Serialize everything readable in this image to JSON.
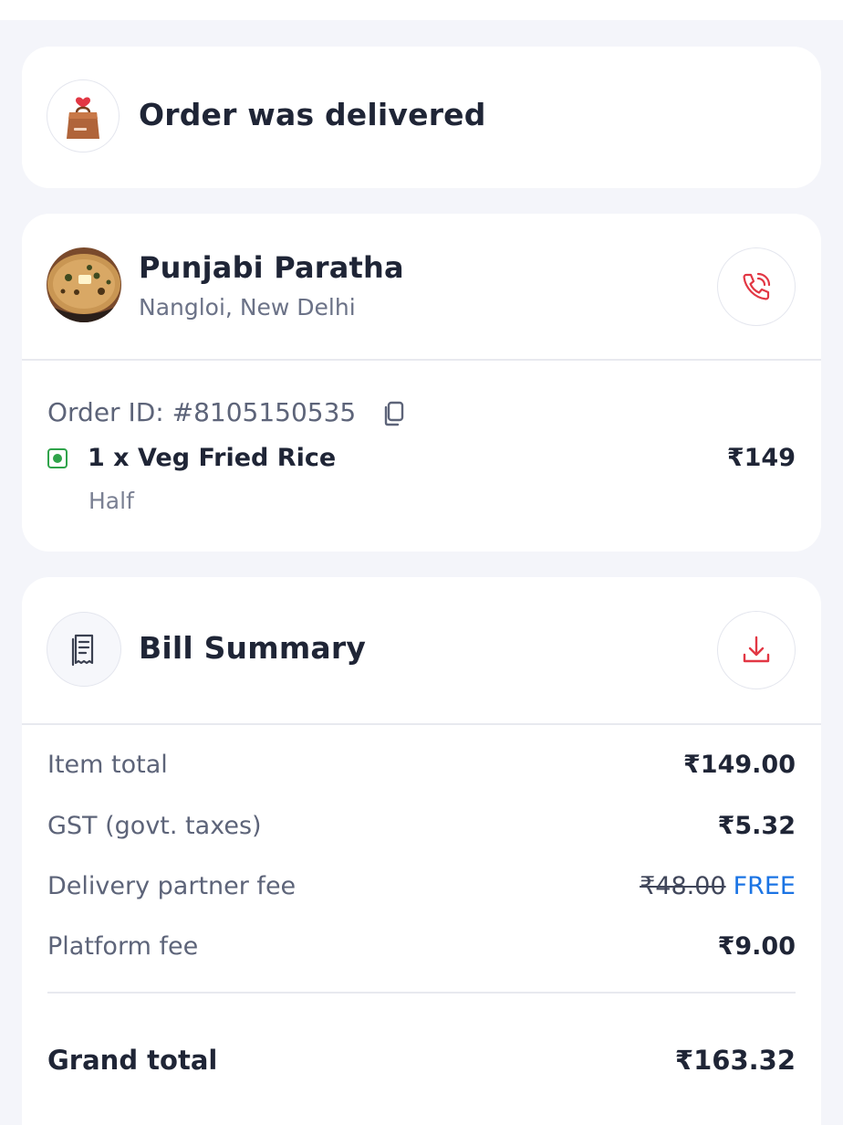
{
  "status_card": {
    "title": "Order was delivered",
    "icon": "delivery-bag-icon"
  },
  "restaurant": {
    "name": "Punjabi Paratha",
    "location": "Nangloi, New Delhi",
    "image": "paratha-food-photo",
    "call_icon": "phone-call-icon"
  },
  "order": {
    "id_label": "Order ID: #8105150535",
    "copy_icon": "copy-icon",
    "item_name": "1 x Veg Fried Rice",
    "item_price": "₹149",
    "item_variant": "Half",
    "veg_indicator_color": "#2fa34a"
  },
  "bill": {
    "title": "Bill Summary",
    "receipt_icon": "receipt-icon",
    "download_icon": "download-icon",
    "item_total_label": "Item total",
    "item_total_value": "₹149.00",
    "gst_label": "GST (govt. taxes)",
    "gst_value": "₹5.32",
    "delivery_label": "Delivery partner fee",
    "delivery_original": "₹48.00",
    "delivery_free": "FREE",
    "platform_label": "Platform fee",
    "platform_value": "₹9.00",
    "grand_label": "Grand total",
    "grand_value": "₹163.32"
  },
  "colors": {
    "accent_red": "#e23744",
    "free_blue": "#1b74e4",
    "background": "#f4f5fa"
  }
}
